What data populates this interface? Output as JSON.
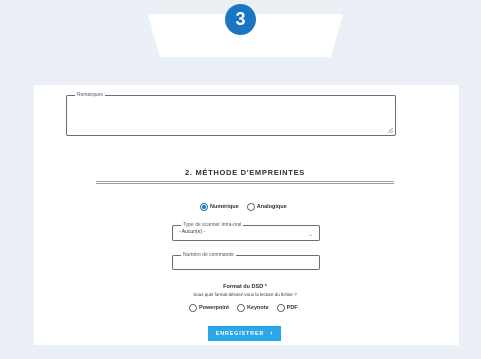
{
  "step": {
    "number": "3"
  },
  "remarks": {
    "label": "Remarques",
    "value": ""
  },
  "section": {
    "title": "2. MÉTHODE D'EMPREINTES"
  },
  "method": {
    "options": [
      {
        "label": "Numérique",
        "selected": true
      },
      {
        "label": "Analogique",
        "selected": false
      }
    ]
  },
  "scanner": {
    "label": "Type de scanner Intra-oral",
    "value": "- Aucun(e) -"
  },
  "order": {
    "label": "Numéro de commande",
    "value": ""
  },
  "format": {
    "title": "Format du DSD *",
    "subtitle": "Sous quel format désirez-vous la lecture du fichier ?",
    "options": [
      {
        "label": "Powerpoint",
        "selected": false
      },
      {
        "label": "Keynote",
        "selected": false
      },
      {
        "label": "PDF",
        "selected": false
      }
    ]
  },
  "save": {
    "label": "ENREGISTRER"
  },
  "colors": {
    "accent": "#1a76c0",
    "button": "#2aa7e6",
    "background": "#eaf0f6"
  }
}
